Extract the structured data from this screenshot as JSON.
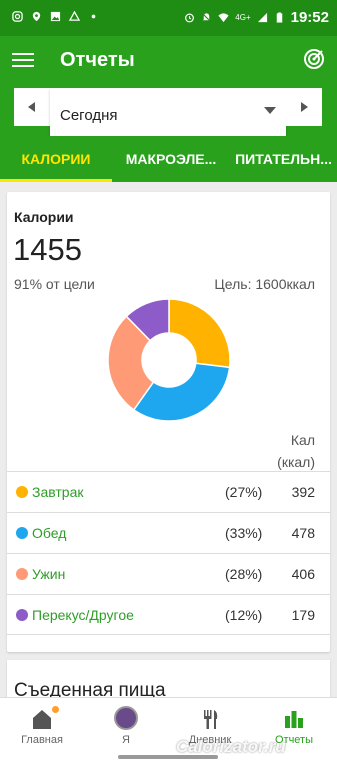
{
  "status_bar": {
    "time": "19:52",
    "network": "4G+"
  },
  "appbar": {
    "title": "Отчеты"
  },
  "date_selector": {
    "value": "Сегодня"
  },
  "tabs": [
    {
      "label": "КАЛОРИИ",
      "active": true
    },
    {
      "label": "МАКРОЭЛЕ...",
      "active": false
    },
    {
      "label": "ПИТАТЕЛЬН...",
      "active": false
    }
  ],
  "calories_card": {
    "title": "Калории",
    "total": "1455",
    "percent_of_goal": "91% от цели",
    "goal": "Цель: 1600ккал",
    "column_header_line1": "Кал",
    "column_header_line2": "(ккал)",
    "meals": [
      {
        "name": "Завтрак",
        "percent": "(27%)",
        "kcal": "392",
        "color": "#ffb300"
      },
      {
        "name": "Обед",
        "percent": "(33%)",
        "kcal": "478",
        "color": "#1ea7ef"
      },
      {
        "name": "Ужин",
        "percent": "(28%)",
        "kcal": "406",
        "color": "#ff9a76"
      },
      {
        "name": "Перекус/Другое",
        "percent": "(12%)",
        "kcal": "179",
        "color": "#8e5cc8"
      }
    ]
  },
  "chart_data": {
    "type": "pie",
    "categories": [
      "Завтрак",
      "Обед",
      "Ужин",
      "Перекус/Другое"
    ],
    "values": [
      392,
      478,
      406,
      179
    ],
    "colors": [
      "#ffb300",
      "#1ea7ef",
      "#ff9a76",
      "#8e5cc8"
    ],
    "title": "",
    "donut": true
  },
  "eaten_food_card": {
    "title": "Съеденная пища"
  },
  "bottom_nav": [
    {
      "label": "Главная",
      "icon": "home-icon",
      "active": false
    },
    {
      "label": "Я",
      "icon": "avatar",
      "active": false
    },
    {
      "label": "Дневник",
      "icon": "cutlery-icon",
      "active": false
    },
    {
      "label": "Отчеты",
      "icon": "bar-chart-icon",
      "active": true
    }
  ],
  "watermark": "Calorizator.ru",
  "colors": {
    "status_bar": "#1f8c14",
    "primary": "#29a11c",
    "accent": "#ffe600",
    "link": "#2e9e28"
  }
}
